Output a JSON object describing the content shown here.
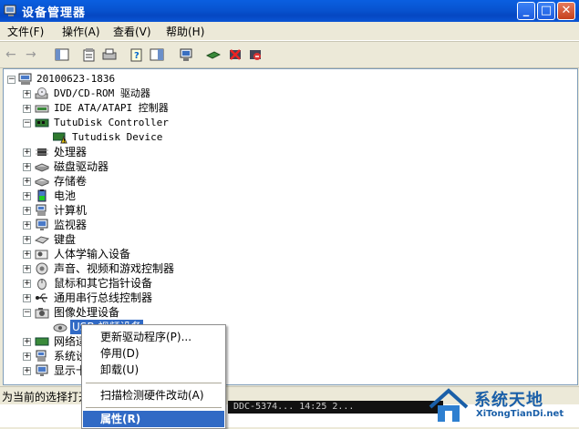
{
  "window": {
    "title": "设备管理器",
    "controls": {
      "minimize": "_",
      "maximize": "□",
      "close": "✕"
    }
  },
  "menubar": {
    "items": [
      "文件(F)",
      "操作(A)",
      "查看(V)",
      "帮助(H)"
    ]
  },
  "toolbar": {
    "back": "←",
    "forward": "→"
  },
  "tree": {
    "root": "20100623-1836",
    "items": [
      {
        "label": "DVD/CD-ROM 驱动器",
        "mono": true
      },
      {
        "label": "IDE ATA/ATAPI 控制器",
        "mono": true
      },
      {
        "label": "TutuDisk Controller",
        "mono": true,
        "expanded": true
      },
      {
        "label": "Tutudisk Device",
        "mono": true,
        "child": true
      },
      {
        "label": "处理器"
      },
      {
        "label": "磁盘驱动器"
      },
      {
        "label": "存储卷"
      },
      {
        "label": "电池"
      },
      {
        "label": "计算机"
      },
      {
        "label": "监视器"
      },
      {
        "label": "键盘"
      },
      {
        "label": "人体学输入设备"
      },
      {
        "label": "声音、视频和游戏控制器"
      },
      {
        "label": "鼠标和其它指针设备"
      },
      {
        "label": "通用串行总线控制器"
      },
      {
        "label": "图像处理设备",
        "expanded": true
      },
      {
        "label": "USB 视频设备",
        "child": true,
        "selected": true
      },
      {
        "label": "网络适配器"
      },
      {
        "label": "系统设备"
      },
      {
        "label": "显示卡"
      }
    ]
  },
  "status": {
    "text": "为当前的选择打开属性页。"
  },
  "background_console": {
    "text": "DDC-5374... 14:25 2..."
  },
  "context_menu": {
    "items": [
      {
        "label": "更新驱动程序(P)..."
      },
      {
        "label": "停用(D)"
      },
      {
        "label": "卸载(U)"
      },
      {
        "label": "扫描检测硬件改动(A)"
      },
      {
        "label": "属性(R)",
        "highlighted": true
      }
    ]
  },
  "watermark": {
    "name": "系统天地",
    "url": "XiTongTianDi.net"
  },
  "colors": {
    "titlebar": "#0A55D4",
    "selection": "#316AC5",
    "chrome": "#ECE9D8"
  }
}
